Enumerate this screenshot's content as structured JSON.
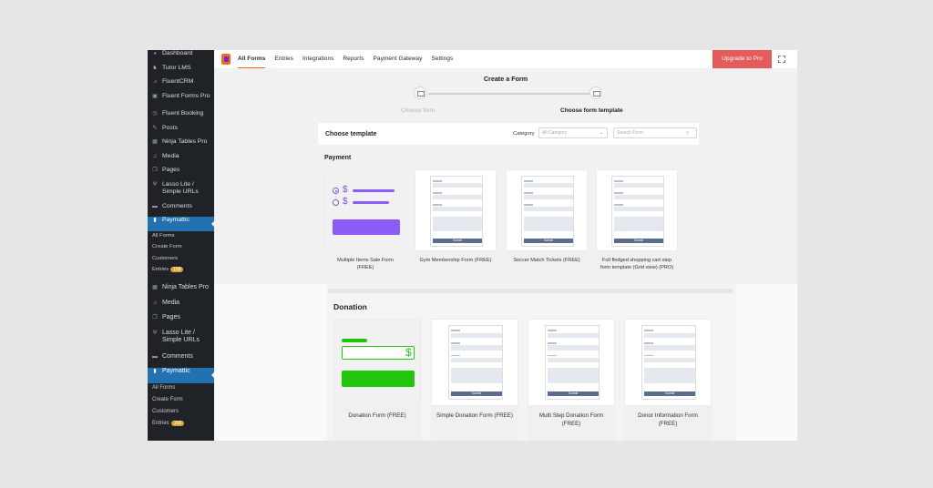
{
  "sidebar1": {
    "items": [
      {
        "label": "Dashboard",
        "icon": "dashboard-icon",
        "glyph": "◕"
      },
      {
        "label": "Tutor LMS",
        "icon": "tutor-lms-icon",
        "glyph": "♞"
      },
      {
        "label": "FluentCRM",
        "icon": "fluentcrm-icon",
        "glyph": "⩘"
      },
      {
        "label": "Fluent Forms Pro",
        "icon": "fluent-forms-icon",
        "glyph": "▣"
      },
      {
        "label": "Fluent Booking",
        "icon": "fluent-booking-icon",
        "glyph": "◷"
      },
      {
        "label": "Posts",
        "icon": "pin-icon",
        "glyph": "✎"
      },
      {
        "label": "Ninja Tables Pro",
        "icon": "ninja-tables-icon",
        "glyph": "▦"
      },
      {
        "label": "Media",
        "icon": "media-icon",
        "glyph": "♫"
      },
      {
        "label": "Pages",
        "icon": "pages-icon",
        "glyph": "❐"
      },
      {
        "label": "Lasso Lite / Simple URLs",
        "icon": "lasso-icon",
        "glyph": "Ψ"
      },
      {
        "label": "Comments",
        "icon": "comments-icon",
        "glyph": "▬"
      },
      {
        "label": "Paymattic",
        "icon": "paymattic-icon",
        "glyph": "▮"
      }
    ],
    "sub": [
      "All Forms",
      "Create Form",
      "Customers",
      "Entries"
    ],
    "entries_badge": "158"
  },
  "sidebar2": {
    "items": [
      {
        "label": "Ninja Tables Pro",
        "icon": "ninja-tables-icon",
        "glyph": "▦"
      },
      {
        "label": "Media",
        "icon": "media-icon",
        "glyph": "♫"
      },
      {
        "label": "Pages",
        "icon": "pages-icon",
        "glyph": "❐"
      },
      {
        "label": "Lasso Lite / Simple URLs",
        "icon": "lasso-icon",
        "glyph": "Ψ"
      },
      {
        "label": "Comments",
        "icon": "comments-icon",
        "glyph": "▬"
      },
      {
        "label": "Paymattic",
        "icon": "paymattic-icon",
        "glyph": "▮"
      }
    ],
    "sub": [
      "All Forms",
      "Create Form",
      "Customers",
      "Entries"
    ],
    "entries_badge": "158"
  },
  "topnav": {
    "tabs": [
      "All Forms",
      "Entries",
      "Integrations",
      "Reports",
      "Payment Gateway",
      "Settings"
    ],
    "upgrade": "Upgrade to Pro"
  },
  "wizard": {
    "title": "Create a Form",
    "step1": "Choose form",
    "step2": "Choose form template"
  },
  "chooser": {
    "title": "Choose template",
    "category_label": "Category",
    "category_placeholder": "All Category",
    "search_placeholder": "Search Form"
  },
  "payment": {
    "title": "Payment",
    "templates": [
      "Multiple Items Sale Form (FREE)",
      "Gym Membership Form (FREE)",
      "Soccer Match Tickets (FREE)",
      "Full fledged shopping cart step form template (Grid view) (PRO)"
    ]
  },
  "donation": {
    "title": "Donation",
    "templates": [
      "Donation Form (FREE)",
      "Simple Donation Form (FREE)",
      "Multi Step Donation Form (FREE)",
      "Donor Information Form (FREE)"
    ]
  },
  "submit_label": "Submit",
  "colors": {
    "accent": "#2271b1",
    "brand": "#f26b21",
    "upgrade": "#e35b5b",
    "purple": "#8b5cf6",
    "green": "#22c40e"
  }
}
